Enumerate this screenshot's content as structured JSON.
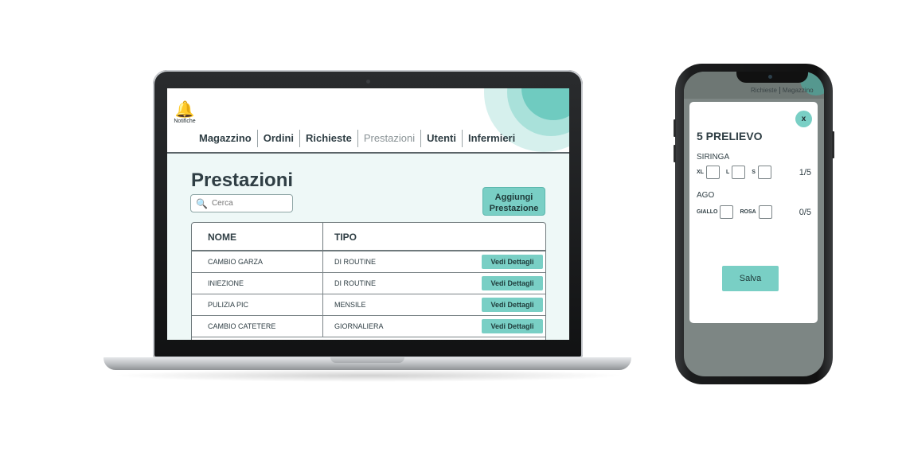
{
  "laptop": {
    "header": {
      "notifications_label": "Notifiche",
      "nav": [
        {
          "label": "Magazzino",
          "active": false
        },
        {
          "label": "Ordini",
          "active": false
        },
        {
          "label": "Richieste",
          "active": false
        },
        {
          "label": "Prestazioni",
          "active": true
        },
        {
          "label": "Utenti",
          "active": false
        },
        {
          "label": "Infermieri",
          "active": false
        }
      ]
    },
    "page_title": "Prestazioni",
    "search": {
      "placeholder": "Cerca"
    },
    "add_button_label": "Aggiungi Prestazione",
    "table": {
      "columns": [
        "NOME",
        "TIPO"
      ],
      "rows": [
        {
          "nome": "CAMBIO GARZA",
          "tipo": "DI ROUTINE",
          "action": "Vedi Dettagli"
        },
        {
          "nome": "INIEZIONE",
          "tipo": "DI ROUTINE",
          "action": "Vedi Dettagli"
        },
        {
          "nome": "PULIZIA PIC",
          "tipo": "MENSILE",
          "action": "Vedi Dettagli"
        },
        {
          "nome": "CAMBIO CATETERE",
          "tipo": "GIORNALIERA",
          "action": "Vedi Dettagli"
        }
      ]
    }
  },
  "phone": {
    "nav": [
      "Richieste",
      "Magazzino"
    ],
    "modal": {
      "close_label": "x",
      "title": "5 PRELIEVO",
      "sections": [
        {
          "label": "SIRINGA",
          "options": [
            "XL",
            "L",
            "S"
          ],
          "counter": "1/5"
        },
        {
          "label": "AGO",
          "options": [
            "GIALLO",
            "ROSA"
          ],
          "counter": "0/5"
        }
      ],
      "save_label": "Salva"
    }
  },
  "colors": {
    "accent": "#79cfc5",
    "text": "#2f3e44",
    "screen_bg": "#eef8f7"
  }
}
